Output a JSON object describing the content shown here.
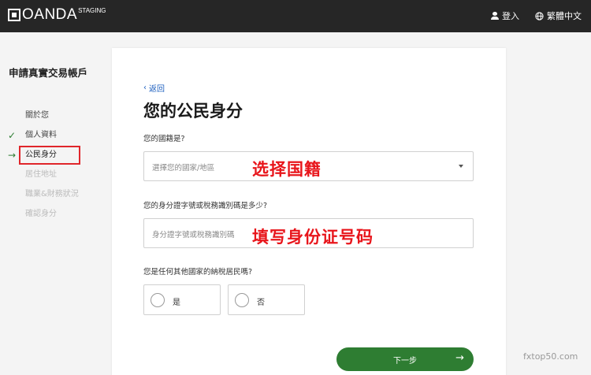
{
  "header": {
    "logo_text": "OANDA",
    "logo_badge": "STAGING",
    "login_label": "登入",
    "language_label": "繁體中文"
  },
  "sidebar": {
    "title": "申請真實交易帳戶",
    "steps": [
      {
        "label": "關於您",
        "state": "plain"
      },
      {
        "label": "個人資料",
        "state": "done",
        "icon": "check-icon"
      },
      {
        "label": "公民身分",
        "state": "active",
        "icon": "arrow-right-icon"
      },
      {
        "label": "居住地址",
        "state": "pending"
      },
      {
        "label": "職業&財務狀況",
        "state": "pending"
      },
      {
        "label": "確認身分",
        "state": "pending"
      }
    ]
  },
  "form": {
    "back_label": "返回",
    "heading": "您的公民身分",
    "nationality_question": "您的國籍是?",
    "nationality_placeholder": "選擇您的國家/地區",
    "id_question": "您的身分證字號或稅務識別碼是多少?",
    "id_placeholder": "身分證字號或稅務識別碼",
    "tax_resident_question": "您是任何其他國家的納稅居民嗎?",
    "option_yes": "是",
    "option_no": "否",
    "next_label": "下一步"
  },
  "annotations": {
    "nationality_note": "选择国籍",
    "id_note": "填写身份证号码"
  },
  "watermark": "fxtop50.com",
  "colors": {
    "topbar": "#262626",
    "accent_green": "#2e7d32",
    "link_blue": "#1d5fbf",
    "annotation_red": "#e8151b"
  }
}
